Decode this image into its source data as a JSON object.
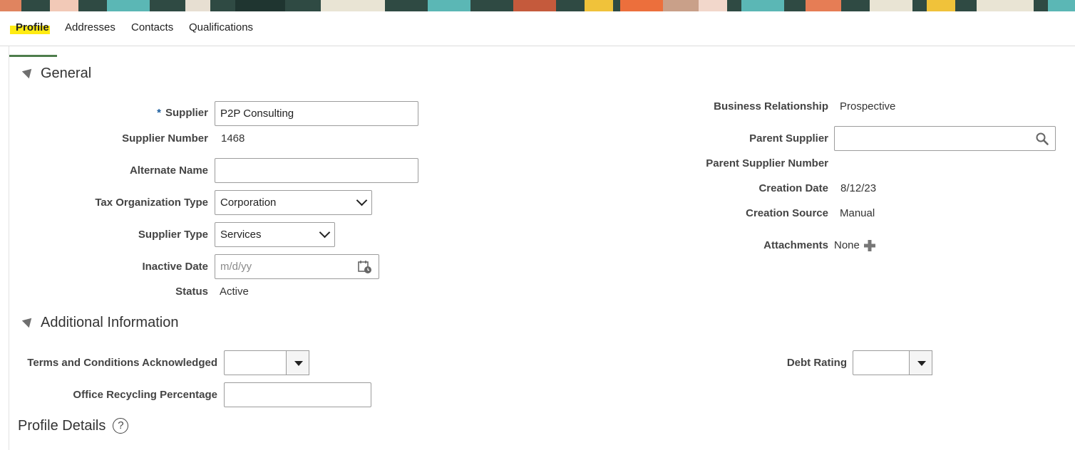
{
  "tabs": [
    {
      "label": "Profile",
      "active": true
    },
    {
      "label": "Addresses"
    },
    {
      "label": "Contacts"
    },
    {
      "label": "Qualifications"
    }
  ],
  "general": {
    "title": "General",
    "supplier": {
      "required_mark": "*",
      "label": "Supplier",
      "value": "P2P Consulting"
    },
    "supplier_number": {
      "label": "Supplier Number",
      "value": "1468"
    },
    "alternate_name": {
      "label": "Alternate Name",
      "value": ""
    },
    "tax_org_type": {
      "label": "Tax Organization Type",
      "value": "Corporation"
    },
    "supplier_type": {
      "label": "Supplier Type",
      "value": "Services"
    },
    "inactive_date": {
      "label": "Inactive Date",
      "placeholder": "m/d/yy"
    },
    "status": {
      "label": "Status",
      "value": "Active"
    },
    "business_relationship": {
      "label": "Business Relationship",
      "value": "Prospective"
    },
    "parent_supplier": {
      "label": "Parent Supplier",
      "value": ""
    },
    "parent_supplier_number": {
      "label": "Parent Supplier Number",
      "value": ""
    },
    "creation_date": {
      "label": "Creation Date",
      "value": "8/12/23"
    },
    "creation_source": {
      "label": "Creation Source",
      "value": "Manual"
    },
    "attachments": {
      "label": "Attachments",
      "value": "None"
    }
  },
  "additional": {
    "title": "Additional Information",
    "terms_ack": {
      "label": "Terms and Conditions Acknowledged",
      "value": ""
    },
    "office_recycling": {
      "label": "Office Recycling Percentage",
      "value": ""
    },
    "debt_rating": {
      "label": "Debt Rating",
      "value": ""
    }
  },
  "profile_details": {
    "title": "Profile Details",
    "help": "?"
  },
  "colors": {
    "tab_highlight": "#ffeb12",
    "tab_underline": "#4e7d4c",
    "required": "#1a5d9e"
  }
}
